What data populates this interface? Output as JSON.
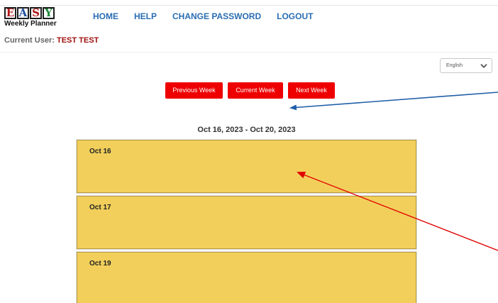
{
  "logo": {
    "letters": [
      "E",
      "A",
      "S",
      "Y"
    ],
    "letter_colors": [
      "#b01818",
      "#1f4ea0",
      "#b01818",
      "#1e8a3a"
    ],
    "subtitle": "Weekly Planner"
  },
  "nav": {
    "items": [
      "HOME",
      "HELP",
      "CHANGE PASSWORD",
      "LOGOUT"
    ],
    "color": "#2a6db3"
  },
  "current_user": {
    "label": "Current User:",
    "name": "TEST TEST"
  },
  "language": {
    "selected": "English",
    "icon": "chevron-down-icon"
  },
  "week_buttons": {
    "previous": "Previous Week",
    "current": "Current Week",
    "next": "Next Week",
    "color": "#ee0000"
  },
  "date_range": "Oct 16, 2023 - Oct 20, 2023",
  "days": [
    {
      "label": "Oct 16"
    },
    {
      "label": "Oct 17"
    },
    {
      "label": "Oct 19"
    }
  ],
  "colors": {
    "day_card": "#f2cf5b",
    "annotation_blue": "#1f5fa8",
    "annotation_red": "#e00000"
  }
}
